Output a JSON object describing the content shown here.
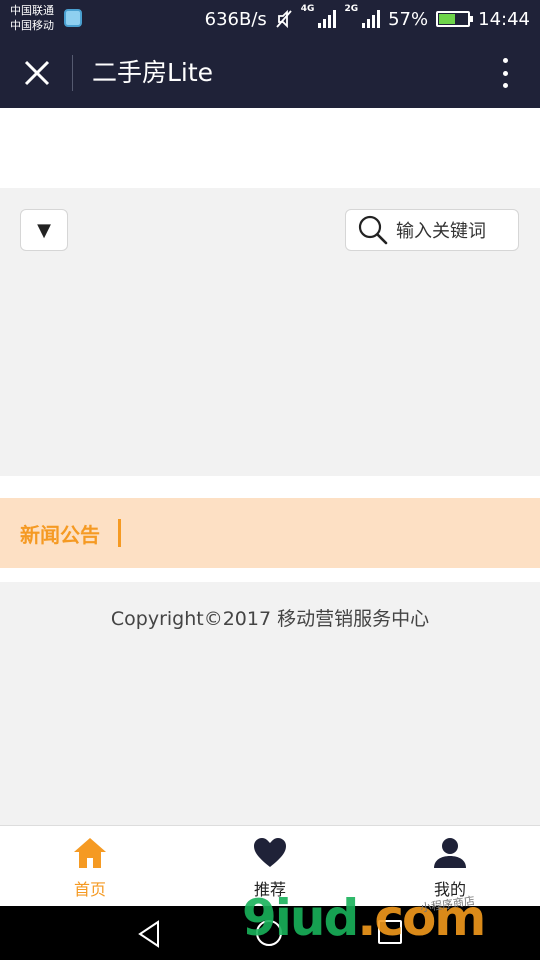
{
  "status_bar": {
    "carrier_1": "中国联通",
    "carrier_2": "中国移动",
    "speed": "636B/s",
    "network_4g": "4G",
    "network_2g": "2G",
    "battery_percent": "57%",
    "battery_level": 0.57,
    "time": "14:44"
  },
  "title_bar": {
    "title": "二手房Lite"
  },
  "filter": {
    "dropdown_glyph": "▼",
    "search_placeholder": "输入关键词"
  },
  "news": {
    "title": "新闻公告"
  },
  "footer": {
    "copyright": "Copyright©2017 移动营销服务中心"
  },
  "tabs": [
    {
      "label": "首页",
      "icon": "home-icon",
      "active": true
    },
    {
      "label": "推荐",
      "icon": "heart-icon",
      "active": false
    },
    {
      "label": "我的",
      "icon": "user-icon",
      "active": false
    }
  ],
  "watermark": {
    "text_green": "9iud",
    "text_orange": ".com",
    "small_text": "小程序商店"
  },
  "colors": {
    "header_bg": "#1f2238",
    "accent": "#f59a23",
    "news_bg": "#fde0c4",
    "icon_dark": "#1f2238"
  }
}
